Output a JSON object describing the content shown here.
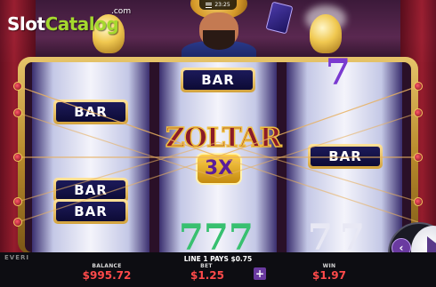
{
  "brand": {
    "slot": "Slot",
    "catalog": "Catalog",
    "com": ".com"
  },
  "status": {
    "time": "23:25",
    "menu_icon": "hamburger-menu-icon"
  },
  "game": {
    "provider": "EVERI",
    "feature_symbol": {
      "title": "ZOLTAR",
      "multiplier": "3X"
    },
    "reels": [
      {
        "symbols": [
          "BAR",
          "BAR",
          "BAR"
        ],
        "sevens": []
      },
      {
        "symbols": [
          "BAR"
        ],
        "sevens": [
          "7",
          "7",
          "7"
        ]
      },
      {
        "symbols": [
          "BAR"
        ],
        "sevens": [
          "7",
          "7",
          "7"
        ]
      }
    ]
  },
  "footer": {
    "line_pays": "LINE 1 PAYS $0.75",
    "balance_label": "BALANCE",
    "balance_value": "$995.72",
    "bet_label": "BET",
    "bet_value": "$1.25",
    "win_label": "WIN",
    "win_value": "$1.97",
    "plus_symbol": "+",
    "prev_symbol": "‹"
  },
  "colors": {
    "value_red": "#ff4a4a",
    "logo_green": "#a5d92e",
    "accent_purple": "#6a3aa0"
  }
}
